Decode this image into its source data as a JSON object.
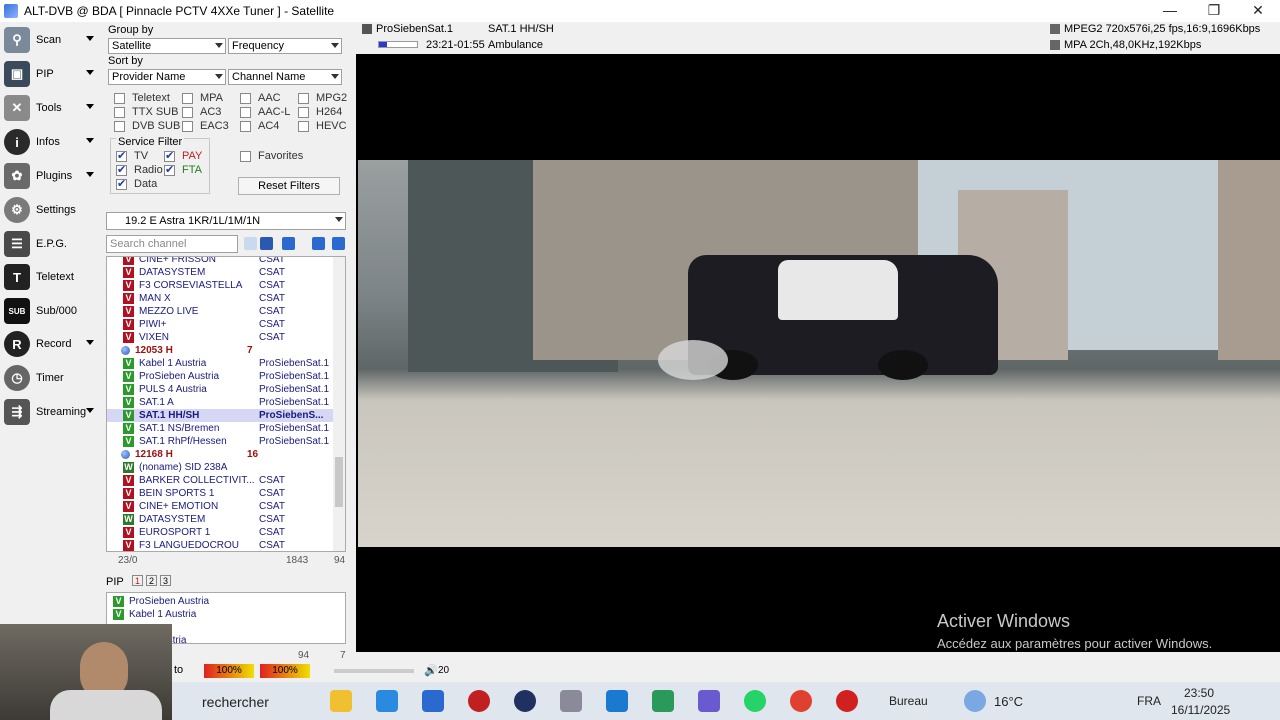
{
  "window": {
    "title": "ALT-DVB @ BDA [ Pinnacle PCTV 4XXe Tuner ] - Satellite",
    "buttons": [
      "—",
      "❐",
      "✕"
    ]
  },
  "nav": [
    {
      "label": "Scan",
      "icon": "satellite-dish-icon",
      "caret": true
    },
    {
      "label": "PIP",
      "icon": "pip-icon",
      "caret": true
    },
    {
      "label": "Tools",
      "icon": "tools-icon",
      "caret": true
    },
    {
      "label": "Infos",
      "icon": "info-icon",
      "caret": true
    },
    {
      "label": "Plugins",
      "icon": "plugins-icon",
      "caret": true
    },
    {
      "label": "Settings",
      "icon": "gear-icon",
      "caret": false
    },
    {
      "label": "E.P.G.",
      "icon": "epg-icon",
      "caret": false
    },
    {
      "label": "Teletext",
      "icon": "teletext-icon",
      "caret": false
    },
    {
      "label": "Sub/000",
      "icon": "subtitle-icon",
      "caret": false
    },
    {
      "label": "Record",
      "icon": "record-icon",
      "caret": true
    },
    {
      "label": "Timer",
      "icon": "timer-icon",
      "caret": false
    },
    {
      "label": "Streaming",
      "icon": "streaming-icon",
      "caret": true
    }
  ],
  "filters": {
    "group_by_label": "Group by",
    "group_by_1": "Satellite",
    "group_by_2": "Frequency",
    "sort_by_label": "Sort by",
    "sort_by_1": "Provider Name",
    "sort_by_2": "Channel Name",
    "checks": {
      "teletext": "Teletext",
      "mpa": "MPA",
      "aac": "AAC",
      "mpg2": "MPG2",
      "ttx_sub": "TTX SUB",
      "ac3": "AC3",
      "aac_l": "AAC-L",
      "h264": "H264",
      "dvb_sub": "DVB SUB",
      "eac3": "EAC3",
      "ac4": "AC4",
      "hevc": "HEVC"
    },
    "service_filter_label": "Service Filter",
    "tv": "TV",
    "pay": "PAY",
    "radio": "Radio",
    "fta": "FTA",
    "data": "Data",
    "favorites": "Favorites",
    "reset_filters": "Reset Filters",
    "satellite": "19.2 E Astra 1KR/1L/1M/1N",
    "search_placeholder": "Search channel"
  },
  "channels": [
    {
      "type": "r",
      "name": "CINE+ FRISSON",
      "provider": "CSAT"
    },
    {
      "type": "r",
      "name": "DATASYSTEM",
      "provider": "CSAT"
    },
    {
      "type": "r",
      "name": "F3 CORSEVIASTELLA",
      "provider": "CSAT"
    },
    {
      "type": "r",
      "name": "MAN X",
      "provider": "CSAT"
    },
    {
      "type": "r",
      "name": "MEZZO LIVE",
      "provider": "CSAT"
    },
    {
      "type": "r",
      "name": "PIWI+",
      "provider": "CSAT"
    },
    {
      "type": "r",
      "name": "VIXEN",
      "provider": "CSAT"
    },
    {
      "type": "tp",
      "name": "12053 H",
      "count": "7"
    },
    {
      "type": "v",
      "name": "Kabel 1 Austria",
      "provider": "ProSiebenSat.1"
    },
    {
      "type": "v",
      "name": "ProSieben Austria",
      "provider": "ProSiebenSat.1"
    },
    {
      "type": "v",
      "name": "PULS 4 Austria",
      "provider": "ProSiebenSat.1"
    },
    {
      "type": "v",
      "name": "SAT.1 A",
      "provider": "ProSiebenSat.1"
    },
    {
      "type": "v",
      "name": "SAT.1 HH/SH",
      "provider": "ProSiebenS...",
      "selected": true
    },
    {
      "type": "v",
      "name": "SAT.1 NS/Bremen",
      "provider": "ProSiebenSat.1"
    },
    {
      "type": "v",
      "name": "SAT.1 RhPf/Hessen",
      "provider": "ProSiebenSat.1"
    },
    {
      "type": "tp",
      "name": "12168 H",
      "count": "16"
    },
    {
      "type": "w",
      "name": "(noname) SID 238A",
      "provider": ""
    },
    {
      "type": "r",
      "name": "BARKER COLLECTIVIT...",
      "provider": "CSAT"
    },
    {
      "type": "r",
      "name": "BEIN SPORTS 1",
      "provider": "CSAT"
    },
    {
      "type": "r",
      "name": "CINE+ EMOTION",
      "provider": "CSAT"
    },
    {
      "type": "w",
      "name": "DATASYSTEM",
      "provider": "CSAT"
    },
    {
      "type": "r",
      "name": "EUROSPORT 1",
      "provider": "CSAT"
    },
    {
      "type": "r",
      "name": "F3 LANGUEDOCROU",
      "provider": "CSAT"
    }
  ],
  "list_footer": {
    "left": "23/0",
    "mid": "1843",
    "right": "94"
  },
  "pip": {
    "label": "PIP",
    "tabs": [
      "1",
      "2",
      "3"
    ],
    "items": [
      "ProSieben Austria",
      "Kabel 1 Austria",
      "...Austria"
    ],
    "footer_left": "94",
    "footer_right": "7"
  },
  "info": {
    "channel": "ProSiebenSat.1",
    "service": "SAT.1 HH/SH",
    "time": "23:21-01:55",
    "program": "Ambulance",
    "video": "MPEG2 720x576i,25 fps,16:9,1696Kbps",
    "audio": "MPA 2Ch,48,0KHz,192Kbps"
  },
  "status": {
    "auto": "to",
    "level1": "100%",
    "level2": "100%",
    "volume": "20"
  },
  "watermark": {
    "line1": "Activer Windows",
    "line2": "Accédez aux paramètres pour activer Windows."
  },
  "taskbar": {
    "search": "rechercher",
    "desktop": "Bureau",
    "weather": "16°C",
    "lang": "FRA",
    "time": "23:50",
    "date": "16/11/2025"
  }
}
